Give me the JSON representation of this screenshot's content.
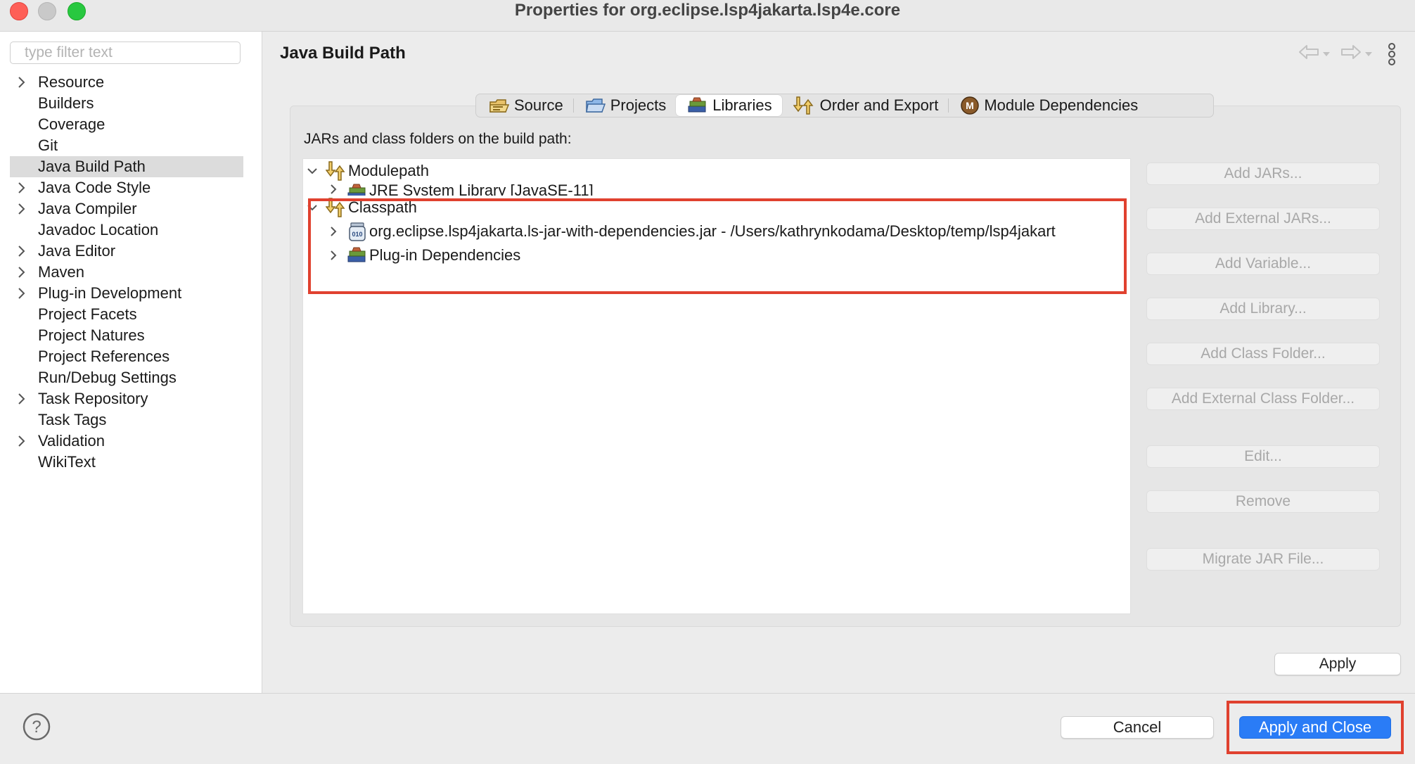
{
  "window": {
    "title": "Properties for org.eclipse.lsp4jakarta.lsp4e.core"
  },
  "filter": {
    "placeholder": "type filter text",
    "value": ""
  },
  "nav": {
    "items": [
      {
        "label": "Resource",
        "expandable": true,
        "selected": false
      },
      {
        "label": "Builders",
        "expandable": false,
        "selected": false
      },
      {
        "label": "Coverage",
        "expandable": false,
        "selected": false
      },
      {
        "label": "Git",
        "expandable": false,
        "selected": false
      },
      {
        "label": "Java Build Path",
        "expandable": false,
        "selected": true
      },
      {
        "label": "Java Code Style",
        "expandable": true,
        "selected": false
      },
      {
        "label": "Java Compiler",
        "expandable": true,
        "selected": false
      },
      {
        "label": "Javadoc Location",
        "expandable": false,
        "selected": false
      },
      {
        "label": "Java Editor",
        "expandable": true,
        "selected": false
      },
      {
        "label": "Maven",
        "expandable": true,
        "selected": false
      },
      {
        "label": "Plug-in Development",
        "expandable": true,
        "selected": false
      },
      {
        "label": "Project Facets",
        "expandable": false,
        "selected": false
      },
      {
        "label": "Project Natures",
        "expandable": false,
        "selected": false
      },
      {
        "label": "Project References",
        "expandable": false,
        "selected": false
      },
      {
        "label": "Run/Debug Settings",
        "expandable": false,
        "selected": false
      },
      {
        "label": "Task Repository",
        "expandable": true,
        "selected": false
      },
      {
        "label": "Task Tags",
        "expandable": false,
        "selected": false
      },
      {
        "label": "Validation",
        "expandable": true,
        "selected": false
      },
      {
        "label": "WikiText",
        "expandable": false,
        "selected": false
      }
    ]
  },
  "page": {
    "title": "Java Build Path"
  },
  "tabs": [
    {
      "label": "Source",
      "icon": "source-folder-icon",
      "active": false
    },
    {
      "label": "Projects",
      "icon": "projects-icon",
      "active": false
    },
    {
      "label": "Libraries",
      "icon": "libraries-icon",
      "active": true
    },
    {
      "label": "Order and Export",
      "icon": "order-export-icon",
      "active": false
    },
    {
      "label": "Module Dependencies",
      "icon": "module-icon",
      "active": false
    }
  ],
  "libraries": {
    "heading": "JARs and class folders on the build path:",
    "tree": {
      "modulepath": {
        "label": "Modulepath",
        "expanded": true
      },
      "jre": {
        "label": "JRE System Library [JavaSE-11]"
      },
      "classpath": {
        "label": "Classpath",
        "expanded": true
      },
      "jar": {
        "label": "org.eclipse.lsp4jakarta.ls-jar-with-dependencies.jar - /Users/kathrynkodama/Desktop/temp/lsp4jakart"
      },
      "plugin": {
        "label": "Plug-in Dependencies"
      }
    },
    "buttons": {
      "add_jars": "Add JARs...",
      "add_external_jars": "Add External JARs...",
      "add_variable": "Add Variable...",
      "add_library": "Add Library...",
      "add_class_folder": "Add Class Folder...",
      "add_external_class_folder": "Add External Class Folder...",
      "edit": "Edit...",
      "remove": "Remove",
      "migrate_jar": "Migrate JAR File..."
    }
  },
  "footer": {
    "apply": "Apply",
    "cancel": "Cancel",
    "apply_and_close": "Apply and Close"
  },
  "colors": {
    "accent": "#2a7cf6",
    "annotation": "#e0412f",
    "selection": "#dcdcdc"
  }
}
